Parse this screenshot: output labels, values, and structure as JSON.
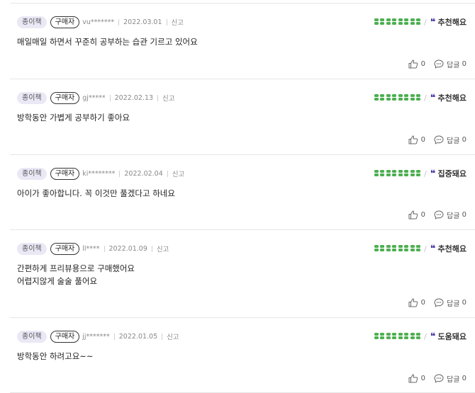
{
  "reviews": [
    {
      "type": "종이책",
      "buyer": "구매자",
      "user": "vu*******",
      "date": "2022.03.01",
      "report": "신고",
      "tag": "추천해요",
      "content": [
        "매일매일 하면서 꾸준히 공부하는 습관 기르고 있어요"
      ],
      "likes": "0",
      "reply_label": "답글",
      "reply_count": "0"
    },
    {
      "type": "종이책",
      "buyer": "구매자",
      "user": "gj*****",
      "date": "2022.02.13",
      "report": "신고",
      "tag": "추천해요",
      "content": [
        "방학동안 가볍게 공부하기 좋아요"
      ],
      "likes": "0",
      "reply_label": "답글",
      "reply_count": "0"
    },
    {
      "type": "종이책",
      "buyer": "구매자",
      "user": "ki********",
      "date": "2022.02.04",
      "report": "신고",
      "tag": "집중돼요",
      "content": [
        "아이가 좋아합니다. 꼭 이것만 풀겠다고 하네요"
      ],
      "likes": "0",
      "reply_label": "답글",
      "reply_count": "0"
    },
    {
      "type": "종이책",
      "buyer": "구매자",
      "user": "ll****",
      "date": "2022.01.09",
      "report": "신고",
      "tag": "추천해요",
      "content": [
        "간편하게 프리뷰용으로 구매했어요",
        "어렵지않게 술술 풀어요"
      ],
      "likes": "0",
      "reply_label": "답글",
      "reply_count": "0"
    },
    {
      "type": "종이책",
      "buyer": "구매자",
      "user": "jj*******",
      "date": "2022.01.05",
      "report": "신고",
      "tag": "도움돼요",
      "content": [
        "방학동안 하려고요~~"
      ],
      "likes": "0",
      "reply_label": "답글",
      "reply_count": "0"
    }
  ],
  "colors": {
    "rating": "#4caf50",
    "tag_quote": "#3b2fa3",
    "badge_bg": "#ebe8f6",
    "divider": "#e6e6e6"
  },
  "icons": {
    "rating": "clover-icon",
    "tag": "quote-icon",
    "like": "thumbs-up-icon",
    "reply": "speech-bubble-icon"
  }
}
